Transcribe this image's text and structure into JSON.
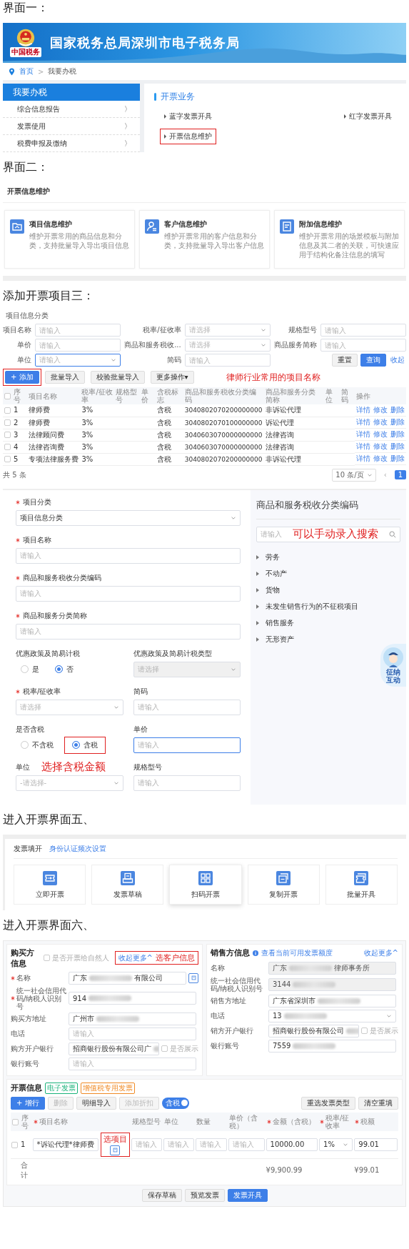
{
  "blocks": [
    {
      "kind": "heading",
      "text": "界面一："
    },
    {
      "kind": "portal",
      "banner": {
        "title": "国家税务总局深圳市电子税务局",
        "emblem_caption": "中国税务"
      },
      "breadcrumb": [
        {
          "label": "首页",
          "link": true
        },
        {
          "label": "我要办税",
          "link": false
        }
      ],
      "breadcrumb_separator": ">",
      "nav": {
        "title": "我要办税",
        "items": [
          {
            "label": "综合信息报告",
            "chevron": "〉"
          },
          {
            "label": "发票使用",
            "chevron": "〉"
          },
          {
            "label": "税费申报及缴纳",
            "chevron": "〉"
          }
        ]
      },
      "section": {
        "title": "开票业务",
        "links": [
          {
            "label": "蓝字发票开具",
            "marked": false
          },
          {
            "label": "红字发票开具",
            "marked": false
          },
          {
            "label": "开票信息维护",
            "marked": true
          }
        ]
      }
    },
    {
      "kind": "heading",
      "text": "界面二："
    },
    {
      "kind": "maintenance",
      "title": "开票信息维护",
      "cards": [
        {
          "title": "项目信息维护",
          "desc": "维护开票常用的商品信息和分类，支持批量导入导出项目信息"
        },
        {
          "title": "客户信息维护",
          "desc": "维护开票常用的客户信息和分类，支持批量导入导出客户信息"
        },
        {
          "title": "附加信息维护",
          "desc": "维护开票常用的场景模板与附加信息及其二者的关联，可快速应用于结构化备注信息的填写"
        }
      ]
    },
    {
      "kind": "heading",
      "text": "添加开票项目三："
    },
    {
      "kind": "item_list",
      "title": "项目信息分类",
      "filters": [
        {
          "label": "项目名称",
          "kind": "input",
          "placeholder": "请输入",
          "focused": false
        },
        {
          "label": "税率/征收率",
          "kind": "select",
          "placeholder": "请选择",
          "focused": false
        },
        {
          "label": "规格型号",
          "kind": "input",
          "placeholder": "请输入",
          "focused": false
        },
        {
          "label": "单价",
          "kind": "input",
          "placeholder": "请输入",
          "focused": false
        },
        {
          "label": "商品和服务税收...",
          "kind": "select",
          "placeholder": "请选择",
          "focused": false
        },
        {
          "label": "商品服务简称",
          "kind": "input",
          "placeholder": "请输入",
          "focused": false
        },
        {
          "label": "单位",
          "kind": "select",
          "placeholder": "请输入",
          "focused": true
        },
        {
          "label": "简码",
          "kind": "input",
          "placeholder": "请输入",
          "focused": false
        }
      ],
      "filter_buttons": [
        {
          "label": "重置",
          "kind": "default"
        },
        {
          "label": "查询",
          "kind": "primary"
        },
        {
          "label": "收起",
          "kind": "link"
        }
      ],
      "actions": [
        {
          "label": "+ 添加",
          "kind": "primary",
          "marked": true
        },
        {
          "label": "批量导入",
          "kind": "default",
          "marked": false
        },
        {
          "label": "校验批量导入",
          "kind": "default",
          "marked": false
        },
        {
          "label": "更多操作▾",
          "kind": "default",
          "marked": false
        }
      ],
      "annotation": "律师行业常用的项目名称",
      "columns": [
        "序号",
        "项目名称",
        "税率/征收率",
        "规格型号",
        "单价",
        "含税标志",
        "商品和服务税收分类编码",
        "商品和服务分类简称",
        "单位",
        "简码",
        "操作"
      ],
      "header_checked": false,
      "rows": [
        {
          "checked": false,
          "no": "1",
          "name": "律师费",
          "rate": "3%",
          "tax_flag": "含税",
          "code": "3040802070200000000",
          "short_name": "非诉讼代理",
          "actions": [
            "详情",
            "修改",
            "删除"
          ]
        },
        {
          "checked": false,
          "no": "2",
          "name": "律师费",
          "rate": "3%",
          "tax_flag": "含税",
          "code": "3040802070100000000",
          "short_name": "诉讼代理",
          "actions": [
            "详情",
            "修改",
            "删除"
          ]
        },
        {
          "checked": false,
          "no": "3",
          "name": "法律顾问费",
          "rate": "3%",
          "tax_flag": "含税",
          "code": "3040603070000000000",
          "short_name": "法律咨询",
          "actions": [
            "详情",
            "修改",
            "删除"
          ]
        },
        {
          "checked": false,
          "no": "4",
          "name": "法律咨询费",
          "rate": "3%",
          "tax_flag": "含税",
          "code": "3040603070000000000",
          "short_name": "法律咨询",
          "actions": [
            "详情",
            "修改",
            "删除"
          ]
        },
        {
          "checked": false,
          "no": "5",
          "name": "专项法律服务费",
          "rate": "3%",
          "tax_flag": "含税",
          "code": "3040802070200000000",
          "short_name": "非诉讼代理",
          "actions": [
            "详情",
            "修改",
            "删除"
          ]
        }
      ],
      "total": "共 5 条",
      "page_size": "10 条/页",
      "pager": [
        {
          "label": "‹",
          "selected": false
        },
        {
          "label": "1",
          "selected": true
        }
      ]
    },
    {
      "kind": "item_form",
      "rows": [
        {
          "fields": [
            {
              "label": "项目分类",
              "required": true,
              "kind": "select",
              "value": "项目信息分类",
              "focused": false,
              "disabled": false
            }
          ]
        },
        {
          "fields": [
            {
              "label": "项目名称",
              "required": true,
              "kind": "input",
              "placeholder": "请输入",
              "focused": false,
              "disabled": false
            }
          ]
        },
        {
          "fields": [
            {
              "label": "商品和服务税收分类编码",
              "required": true,
              "kind": "input",
              "placeholder": "请输入",
              "focused": false,
              "disabled": false
            }
          ]
        },
        {
          "fields": [
            {
              "label": "商品和服务分类简称",
              "required": true,
              "kind": "input",
              "placeholder": "请输入",
              "focused": false,
              "disabled": false
            }
          ]
        },
        {
          "fields": [
            {
              "label": "优惠政策及简易计税",
              "required": false,
              "kind": "radio",
              "options": [
                {
                  "label": "是",
                  "selected": false,
                  "marked": false
                },
                {
                  "label": "否",
                  "selected": true,
                  "marked": false
                }
              ]
            },
            {
              "label": "优惠政策及简易计税类型",
              "required": false,
              "kind": "select",
              "placeholder": "请选择",
              "focused": false,
              "disabled": true
            }
          ]
        },
        {
          "fields": [
            {
              "label": "税率/征收率",
              "required": true,
              "kind": "select",
              "placeholder": "请选择",
              "focused": false,
              "disabled": false
            },
            {
              "label": "简码",
              "required": false,
              "kind": "input",
              "placeholder": "请输入",
              "focused": false,
              "disabled": false
            }
          ]
        },
        {
          "fields": [
            {
              "label": "是否含税",
              "required": false,
              "kind": "radio",
              "options": [
                {
                  "label": "不含税",
                  "selected": false,
                  "marked": false
                },
                {
                  "label": "含税",
                  "selected": true,
                  "marked": true
                }
              ]
            },
            {
              "label": "单价",
              "required": false,
              "kind": "input",
              "placeholder": "请输入",
              "focused": true,
              "disabled": false
            }
          ]
        },
        {
          "annotation": "选择含税金额",
          "fields": [
            {
              "label": "单位",
              "required": false,
              "kind": "select",
              "placeholder": "-请选择-",
              "focused": false,
              "disabled": false
            },
            {
              "label": "规格型号",
              "required": false,
              "kind": "input",
              "placeholder": "请输入",
              "focused": false,
              "disabled": false
            }
          ]
        }
      ],
      "side": {
        "title": "商品和服务税收分类编码",
        "search": {
          "kind": "search",
          "placeholder": "请输入"
        },
        "search_annotation": "可以手动录入搜索",
        "tree": [
          {
            "label": "劳务",
            "expanded": false
          },
          {
            "label": "不动产",
            "expanded": false
          },
          {
            "label": "货物",
            "expanded": false
          },
          {
            "label": "未发生销售行为的不征税项目",
            "expanded": false
          },
          {
            "label": "销售服务",
            "expanded": false
          },
          {
            "label": "无形资产",
            "expanded": false
          }
        ],
        "mascot": "征纳互动"
      }
    },
    {
      "kind": "heading",
      "text": "进入开票界面五、"
    },
    {
      "kind": "invoice_entry",
      "title": "发票填开",
      "link": "身份认证频次设置",
      "tiles": [
        {
          "label": "立即开票",
          "raised": false
        },
        {
          "label": "发票草稿",
          "raised": false
        },
        {
          "label": "扫码开票",
          "raised": true
        },
        {
          "label": "复制开票",
          "raised": false
        },
        {
          "label": "批量开具",
          "raised": false
        }
      ]
    },
    {
      "kind": "heading",
      "text": "进入开票界面六、"
    },
    {
      "kind": "invoice_form",
      "buyer": {
        "title": "购买方信息",
        "option": {
          "label": "是否开票给自然人",
          "checked": false
        },
        "collapse_link": "收起更多^",
        "annotation": "选客户信息",
        "fields": [
          {
            "label": "名称",
            "required": true,
            "kind": "input",
            "value": "广东",
            "tail": "有限公司",
            "redacted": true,
            "disabled": false,
            "picker": true
          },
          {
            "label": "统一社会信用代码/纳税人识别号",
            "required": true,
            "kind": "input",
            "value": "914",
            "redacted": true,
            "disabled": false,
            "picker": false
          },
          {
            "label": "购买方地址",
            "required": false,
            "kind": "input",
            "value": "广州市",
            "redacted": true,
            "disabled": false,
            "picker": false
          },
          {
            "label": "电话",
            "required": false,
            "kind": "input",
            "placeholder": "请输入",
            "redacted": false,
            "disabled": false,
            "picker": false
          },
          {
            "label": "购方开户银行",
            "required": false,
            "kind": "input",
            "value": "招商银行股份有限公司广",
            "redacted": true,
            "disabled": false,
            "picker": false,
            "show_option": {
              "label": "是否展示",
              "checked": false
            }
          },
          {
            "label": "银行账号",
            "required": false,
            "kind": "input",
            "placeholder": "请输入",
            "redacted": false,
            "disabled": false,
            "picker": false
          }
        ]
      },
      "seller": {
        "title": "销售方信息",
        "info_link": "查看当前可用发票额度",
        "collapse_link": "收起更多^",
        "fields": [
          {
            "label": "名称",
            "required": false,
            "kind": "input",
            "value": "广东",
            "tail": "律师事务所",
            "redacted": true,
            "disabled": true,
            "picker": false
          },
          {
            "label": "统一社会信用代码/纳税人识别号",
            "required": false,
            "kind": "input",
            "value": "3144",
            "redacted": true,
            "disabled": true,
            "picker": false
          },
          {
            "label": "销售方地址",
            "required": false,
            "kind": "input",
            "value": "广东省深圳市",
            "redacted": true,
            "disabled": false,
            "picker": false
          },
          {
            "label": "电话",
            "required": false,
            "kind": "select",
            "value": "13",
            "redacted": true,
            "disabled": false,
            "picker": false
          },
          {
            "label": "销方开户银行",
            "required": false,
            "kind": "input",
            "value": "招商银行股份有限公司",
            "redacted": true,
            "disabled": false,
            "picker": false,
            "show_option": {
              "label": "是否展示",
              "checked": false
            }
          },
          {
            "label": "银行账号",
            "required": false,
            "kind": "input",
            "value": "7559",
            "redacted": true,
            "disabled": false,
            "picker": false
          }
        ]
      },
      "lines": {
        "title": "开票信息",
        "tags": [
          {
            "label": "电子发票",
            "color": "#19b37a"
          },
          {
            "label": "增值税专用发票",
            "color": "#f08a24"
          }
        ],
        "toolbar": [
          {
            "label": "+ 增行",
            "kind": "primary",
            "disabled": false
          },
          {
            "label": "删除",
            "kind": "default",
            "disabled": true
          },
          {
            "label": "明细导入",
            "kind": "default",
            "disabled": false
          },
          {
            "label": "添加折扣",
            "kind": "default",
            "disabled": true
          }
        ],
        "tax_toggle": {
          "label": "含税",
          "on": true
        },
        "right_buttons": [
          "重选发票类型",
          "清空重填"
        ],
        "columns": [
          {
            "label": "序号",
            "required": false
          },
          {
            "label": "项目名称",
            "required": true
          },
          {
            "label": "规格型号",
            "required": false
          },
          {
            "label": "单位",
            "required": false
          },
          {
            "label": "数量",
            "required": false
          },
          {
            "label": "单价（含税）",
            "required": false
          },
          {
            "label": "金额（含税）",
            "required": true
          },
          {
            "label": "税率/征收率",
            "required": true
          },
          {
            "label": "税额",
            "required": true
          }
        ],
        "header_checked": false,
        "rows": [
          {
            "checked": false,
            "cells": [
              {
                "kind": "text",
                "value": "1"
              },
              {
                "kind": "item",
                "value": "*诉讼代理*律师费",
                "picker_annotation": "选项目"
              },
              {
                "kind": "input",
                "placeholder": "请输入"
              },
              {
                "kind": "input",
                "placeholder": "请输入"
              },
              {
                "kind": "input",
                "placeholder": "请输入"
              },
              {
                "kind": "input",
                "placeholder": "请输入"
              },
              {
                "kind": "input",
                "value": "10000.00"
              },
              {
                "kind": "select",
                "value": "1%"
              },
              {
                "kind": "input",
                "value": "99.01"
              }
            ]
          }
        ],
        "total_label": "合计",
        "totals": [
          "¥9,900.99",
          "¥99.01"
        ],
        "footer_buttons": [
          {
            "label": "保存草稿",
            "kind": "default"
          },
          {
            "label": "预览发票",
            "kind": "default"
          },
          {
            "label": "发票开具",
            "kind": "primary"
          }
        ]
      }
    }
  ]
}
